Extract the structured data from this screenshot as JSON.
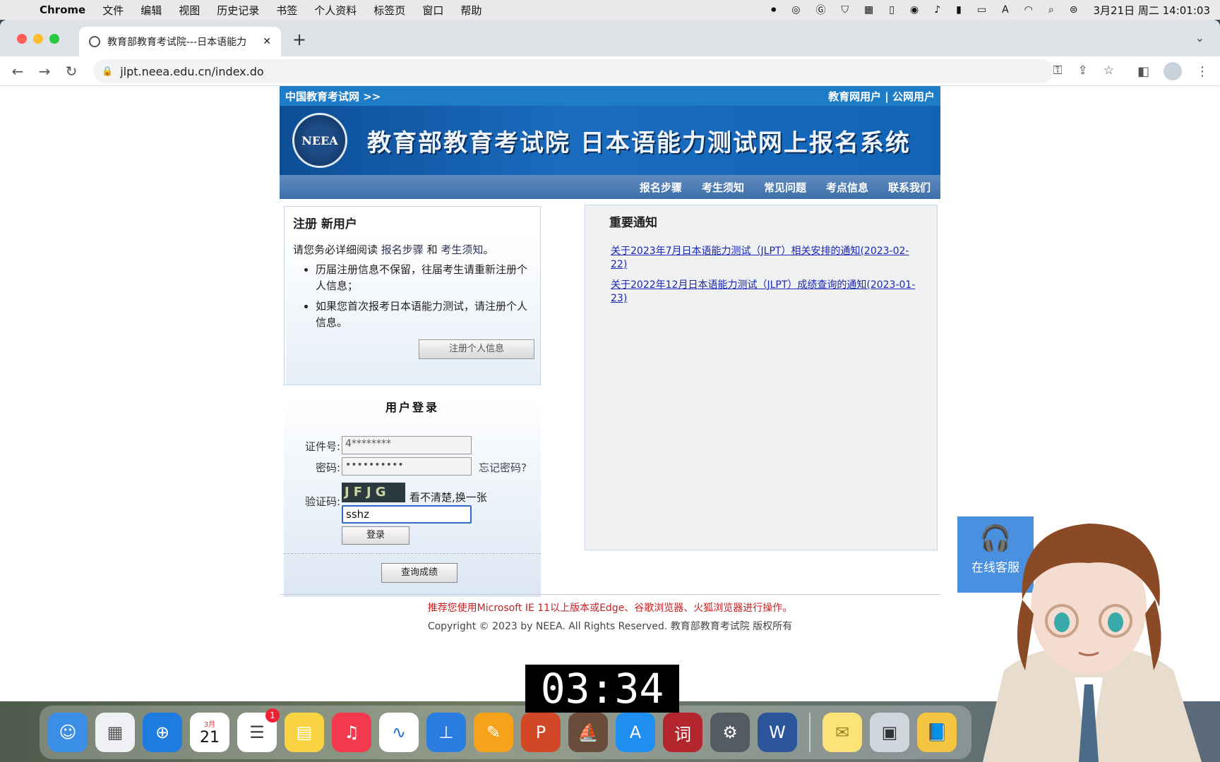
{
  "menubar": {
    "app_name": "Chrome",
    "items": [
      "文件",
      "编辑",
      "视图",
      "历史记录",
      "书签",
      "个人资料",
      "标签页",
      "窗口",
      "帮助"
    ],
    "input_method": "A",
    "datetime": "3月21日 周二 14:01:03"
  },
  "browser": {
    "tab_title": "教育部教育考试院---日本语能力",
    "url": "jlpt.neea.edu.cn/index.do"
  },
  "site": {
    "top_left_link": "中国教育考试网 >>",
    "top_right_links": "教育网用户 | 公网用户",
    "logo_text": "NEEA",
    "banner_title": "教育部教育考试院   日本语能力测试网上报名系统",
    "nav": [
      "报名步骤",
      "考生须知",
      "常见问题",
      "考点信息",
      "联系我们"
    ]
  },
  "register": {
    "title": "注册 新用户",
    "intro_prefix": "请您务必详细阅读",
    "intro_link1": "报名步骤",
    "intro_and": "和",
    "intro_link2": "考生须知",
    "intro_suffix": "。",
    "bullets": [
      "历届注册信息不保留，往届考生请重新注册个人信息；",
      "如果您首次报考日本语能力测试，请注册个人信息。"
    ],
    "button": "注册个人信息"
  },
  "login": {
    "title": "用户登录",
    "id_label": "证件号:",
    "id_value": "4********",
    "password_label": "密码:",
    "password_value": "••••••••••",
    "forgot_label": "忘记密码?",
    "captcha_label": "验证码:",
    "captcha_image_text": "JFJG",
    "captcha_refresh": "看不清楚,换一张",
    "captcha_value": "sshz",
    "login_button": "登录",
    "score_button": "查询成绩"
  },
  "notice": {
    "title": "重要通知",
    "items": [
      "关于2023年7月日本语能力测试（JLPT）相关安排的通知(2023-02-22)",
      "关于2022年12月日本语能力测试（JLPT）成绩查询的通知(2023-01-23)"
    ]
  },
  "footer": {
    "recommend": "推荐您使用Microsoft IE 11以上版本或Edge、谷歌浏览器、火狐浏览器进行操作。",
    "copyright": "Copyright © 2023 by NEEA. All Rights Reserved. 教育部教育考试院 版权所有"
  },
  "widget": {
    "label": "在线客服"
  },
  "timer": "03:34",
  "dock": {
    "calendar_month": "3月",
    "calendar_day": "21",
    "reminders_badge": "1",
    "dict_label": "词",
    "word_label": "W",
    "ppt_label": "P"
  }
}
